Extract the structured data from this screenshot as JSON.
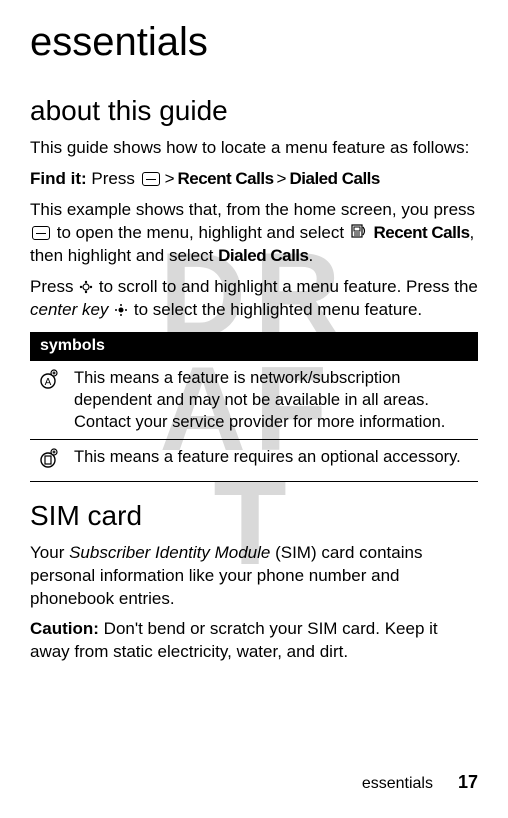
{
  "watermark": "DRAFT",
  "title": "essentials",
  "section1": {
    "heading": "about this guide",
    "p1": "This guide shows how to locate a menu feature as follows:",
    "findit_label": "Find it:",
    "findit_press": " Press ",
    "gt": ">",
    "recent_calls": "Recent Calls",
    "dialed_calls": "Dialed Calls",
    "p3a": "This example shows that, from the home screen, you press ",
    "p3b": " to open the menu, highlight and select ",
    "p3c": ", then highlight and select ",
    "p3d": ".",
    "p4a": "Press ",
    "p4b": " to scroll to and highlight a menu feature. Press the ",
    "center_key": "center key",
    "p4c": " to select the highlighted menu feature."
  },
  "symbols_table": {
    "header": "symbols",
    "rows": [
      {
        "icon": "network",
        "text": "This means a feature is network/subscription dependent and may not be available in all areas. Contact your service provider for more information."
      },
      {
        "icon": "accessory",
        "text": "This means a feature requires an optional accessory."
      }
    ]
  },
  "section2": {
    "heading": "SIM card",
    "p1a": "Your ",
    "p1_sim": "Subscriber Identity Module",
    "p1b": " (SIM) card contains personal information like your phone number and phonebook entries.",
    "caution_label": "Caution:",
    "p2": " Don't bend or scratch your SIM card. Keep it away from static electricity, water, and dirt."
  },
  "footer": {
    "label": "essentials",
    "page": "17"
  }
}
